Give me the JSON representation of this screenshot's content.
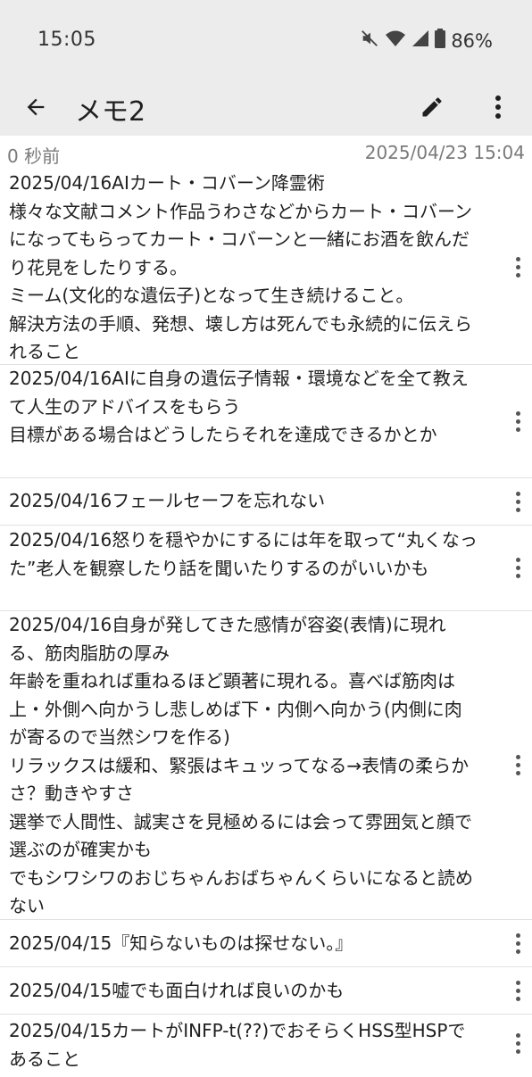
{
  "status_bar": {
    "time": "15:05",
    "battery": "86%",
    "icons": [
      "mute-icon",
      "wifi-icon",
      "signal-icon",
      "battery-icon"
    ]
  },
  "app_bar": {
    "title": "メモ2",
    "back_icon": "arrow-back-icon",
    "edit_icon": "pencil-icon",
    "more_icon": "more-vert-icon"
  },
  "meta": {
    "relative_time": "0 秒前",
    "timestamp": "2025/04/23 15:04"
  },
  "items": [
    {
      "text": "2025/04/16AIカート・コバーン降霊術\n様々な文献コメント作品うわさなどからカート・コバーンになってもらってカート・コバーンと一緒にお酒を飲んだり花見をしたりする。\nミーム(文化的な遺伝子)となって生き続けること。\n解決方法の手順、発想、壊し方は死んでも永続的に伝えられること"
    },
    {
      "text": "2025/04/16AIに自身の遺伝子情報・環境などを全て教えて人生のアドバイスをもらう\n目標がある場合はどうしたらそれを達成できるかとか"
    },
    {
      "text": "2025/04/16フェールセーフを忘れない"
    },
    {
      "text": "2025/04/16怒りを穏やかにするには年を取って“丸くなった”老人を観察したり話を聞いたりするのがいいかも"
    },
    {
      "text": "2025/04/16自身が発してきた感情が容姿(表情)に現れる、筋肉脂肪の厚み\n年齢を重ねれば重ねるほど顕著に現れる。喜べば筋肉は上・外側へ向かうし悲しめば下・内側へ向かう(内側に肉が寄るので当然シワを作る)\nリラックスは緩和、緊張はキュッってなる→表情の柔らかさ？動きやすさ\n選挙で人間性、誠実さを見極めるには会って雰囲気と顔で選ぶのが確実かも\nでもシワシワのおじちゃんおばちゃんくらいになると読めない"
    },
    {
      "text": "2025/04/15『知らないものは探せない。』"
    },
    {
      "text": "2025/04/15嘘でも面白ければ良いのかも"
    },
    {
      "text": "2025/04/15カートがINFP-t(??)でおそらくHSS型HSPであること"
    }
  ]
}
